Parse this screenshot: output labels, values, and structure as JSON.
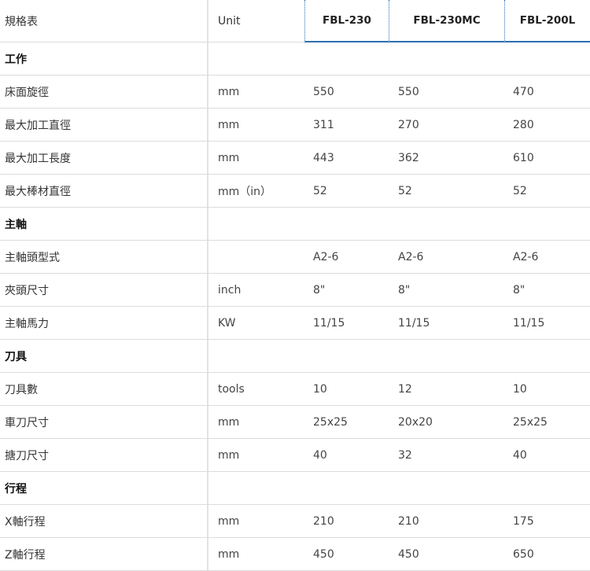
{
  "header": {
    "name": "規格表",
    "unit": "Unit",
    "models": [
      "FBL-230",
      "FBL-230MC",
      "FBL-200L"
    ]
  },
  "rows": [
    {
      "type": "section",
      "name": "工作"
    },
    {
      "type": "data",
      "name": "床面旋徑",
      "unit": "mm",
      "values": [
        "550",
        "550",
        "470"
      ]
    },
    {
      "type": "data",
      "name": "最大加工直徑",
      "unit": "mm",
      "values": [
        "311",
        "270",
        "280"
      ]
    },
    {
      "type": "data",
      "name": "最大加工長度",
      "unit": "mm",
      "values": [
        "443",
        "362",
        "610"
      ]
    },
    {
      "type": "data",
      "name": "最大棒材直徑",
      "unit": "mm（in）",
      "values": [
        "52",
        "52",
        "52"
      ]
    },
    {
      "type": "section",
      "name": "主軸"
    },
    {
      "type": "data",
      "name": "主軸頭型式",
      "unit": "",
      "values": [
        "A2-6",
        "A2-6",
        "A2-6"
      ]
    },
    {
      "type": "data",
      "name": "夾頭尺寸",
      "unit": "inch",
      "values": [
        "8\"",
        "8\"",
        "8\""
      ]
    },
    {
      "type": "data",
      "name": "主軸馬力",
      "unit": "KW",
      "values": [
        "11/15",
        "11/15",
        "11/15"
      ]
    },
    {
      "type": "section",
      "name": "刀具"
    },
    {
      "type": "data",
      "name": "刀具數",
      "unit": "tools",
      "values": [
        "10",
        "12",
        "10"
      ]
    },
    {
      "type": "data",
      "name": "車刀尺寸",
      "unit": "mm",
      "values": [
        "25x25",
        "20x20",
        "25x25"
      ]
    },
    {
      "type": "data",
      "name": "搪刀尺寸",
      "unit": "mm",
      "values": [
        "40",
        "32",
        "40"
      ]
    },
    {
      "type": "section",
      "name": "行程"
    },
    {
      "type": "data",
      "name": "X軸行程",
      "unit": "mm",
      "values": [
        "210",
        "210",
        "175"
      ]
    },
    {
      "type": "data",
      "name": "Z軸行程",
      "unit": "mm",
      "values": [
        "450",
        "450",
        "650"
      ]
    }
  ]
}
